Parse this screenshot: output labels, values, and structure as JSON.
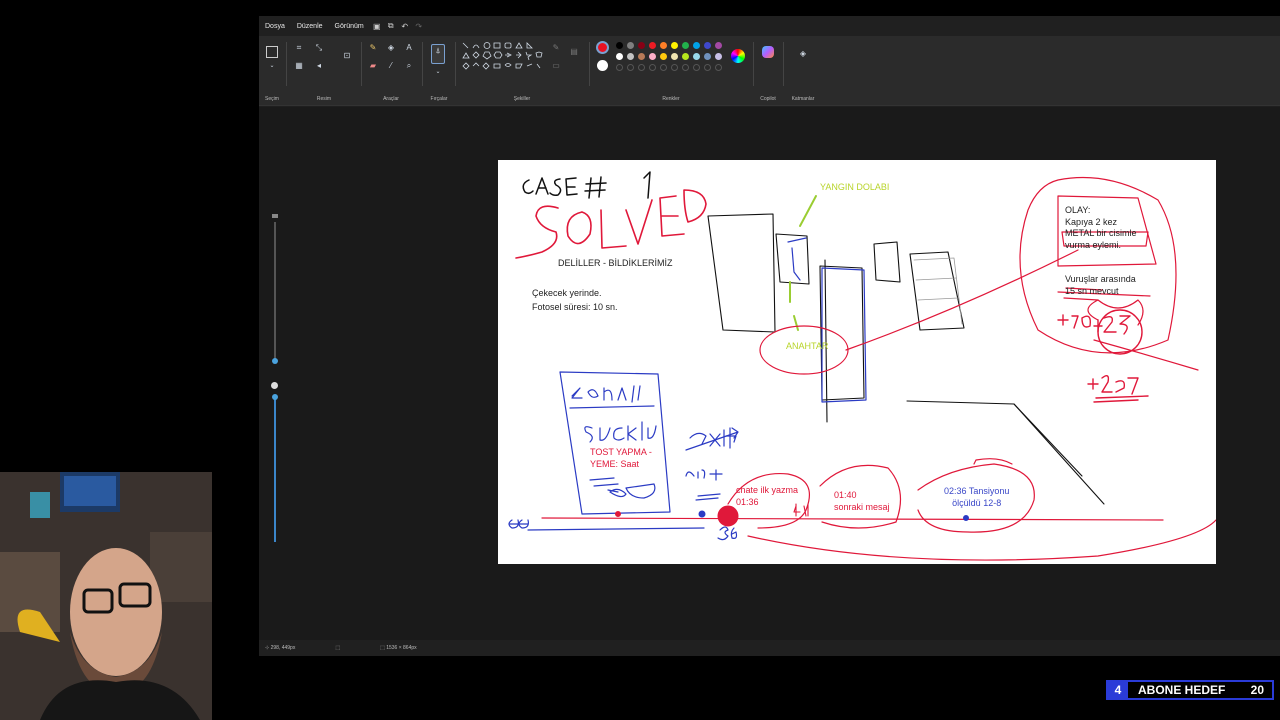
{
  "menu": {
    "file": "Dosya",
    "edit": "Düzenle",
    "view": "Görünüm"
  },
  "ribbon": {
    "selection": "Seçim",
    "image": "Resim",
    "tools": "Araçlar",
    "brushes": "Fırçalar",
    "shapes": "Şekiller",
    "colors": "Renkler",
    "copilot": "Copilot",
    "layers": "Katmanlar"
  },
  "palette": {
    "primary": "#e81123",
    "secondary": "#ffffff",
    "row1": [
      "#000000",
      "#7f7f7f",
      "#880015",
      "#ed1c24",
      "#ff7f27",
      "#fff200",
      "#22b14c",
      "#00a2e8",
      "#3f48cc",
      "#a349a4"
    ],
    "row2": [
      "#ffffff",
      "#c3c3c3",
      "#b97a57",
      "#ffaec9",
      "#ffc90e",
      "#efe4b0",
      "#b5e61d",
      "#99d9ea",
      "#7092be",
      "#c8bfe7"
    ]
  },
  "status": {
    "cursor": "298, 449px",
    "size": "1536 × 864px"
  },
  "canvas": {
    "deliller": "DELİLLER - BİLDİKLERİMİZ",
    "cekecek": "Çekecek yerinde.",
    "fotosel": "Fotosel süresi: 10 sn.",
    "yangin": "YANGIN DOLABI",
    "anahtar": "ANAHTAR",
    "olay_1": "OLAY:",
    "olay_2": "Kapıya 2 kez",
    "olay_3": "METAL bir cisimle",
    "olay_4": "vurma eylemi.",
    "vurus_1": "Vuruşlar arasında",
    "vurus_2": "15 sn mevcut",
    "tost_1": "TOST YAPMA -",
    "tost_2": "YEME: Saat",
    "chate_1": "chate ilk yazma",
    "chate_2": "01:36",
    "sonraki_1": "01:40",
    "sonraki_2": "sonraki mesaj",
    "tansiyon_1": "02:36 Tansiyonu",
    "tansiyon_2": "ölçüldü 12-8"
  },
  "goal": {
    "current": "4",
    "label": "ABONE HEDEF",
    "target": "20"
  }
}
